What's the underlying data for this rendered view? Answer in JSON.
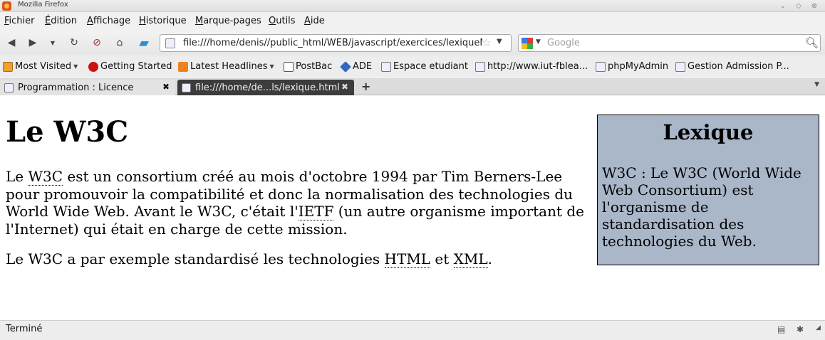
{
  "window": {
    "title": "Mozilla Firefox"
  },
  "menubar": {
    "items": [
      "Fichier",
      "Édition",
      "Affichage",
      "Historique",
      "Marque-pages",
      "Outils",
      "Aide"
    ]
  },
  "navbar": {
    "url": "file:///home/denis//public_html/WEB/javascript/exercices/lexiqueM",
    "search_placeholder": "Google"
  },
  "bookmarks": {
    "items": [
      {
        "label": "Most Visited",
        "icon": "folder-icon"
      },
      {
        "label": "Getting Started",
        "icon": "redhat-icon"
      },
      {
        "label": "Latest Headlines",
        "icon": "rss-icon"
      },
      {
        "label": "PostBac",
        "icon": "page-icon"
      },
      {
        "label": "ADE",
        "icon": "ade-icon"
      },
      {
        "label": "Espace etudiant",
        "icon": "page-icon"
      },
      {
        "label": "http://www.iut-fblea...",
        "icon": "page-icon"
      },
      {
        "label": "phpMyAdmin",
        "icon": "page-icon"
      },
      {
        "label": "Gestion Admission P...",
        "icon": "page-icon"
      }
    ]
  },
  "tabs": [
    {
      "label": "Programmation : Licence",
      "active": false
    },
    {
      "label": "file:///home/de...ls/lexique.html",
      "active": true
    }
  ],
  "page": {
    "heading": "Le W3C",
    "p1": {
      "t1": "Le ",
      "abbr_w3c": "W3C",
      "t2": " est un consortium créé au mois d'octobre 1994 par Tim Berners-Lee pour promouvoir la compatibilité et donc la normalisation des technologies du World Wide Web. Avant le W3C, c'était l'",
      "abbr_ietf": "IETF",
      "t3": " (un autre organisme important de l'Internet) qui était en charge de cette mission."
    },
    "p2": {
      "t1": "Le W3C a par exemple standardisé les technologies ",
      "abbr_html": "HTML",
      "t2": " et ",
      "abbr_xml": "XML",
      "t3": "."
    },
    "lexique": {
      "title": "Lexique",
      "definition": "W3C : Le W3C (World Wide Web Consortium) est l'organisme de standardisation des technologies du Web."
    }
  },
  "status": {
    "message": "Terminé"
  },
  "colors": {
    "lexique_bg": "#a9b7c9",
    "active_tab_bg": "#3c3c3c"
  }
}
